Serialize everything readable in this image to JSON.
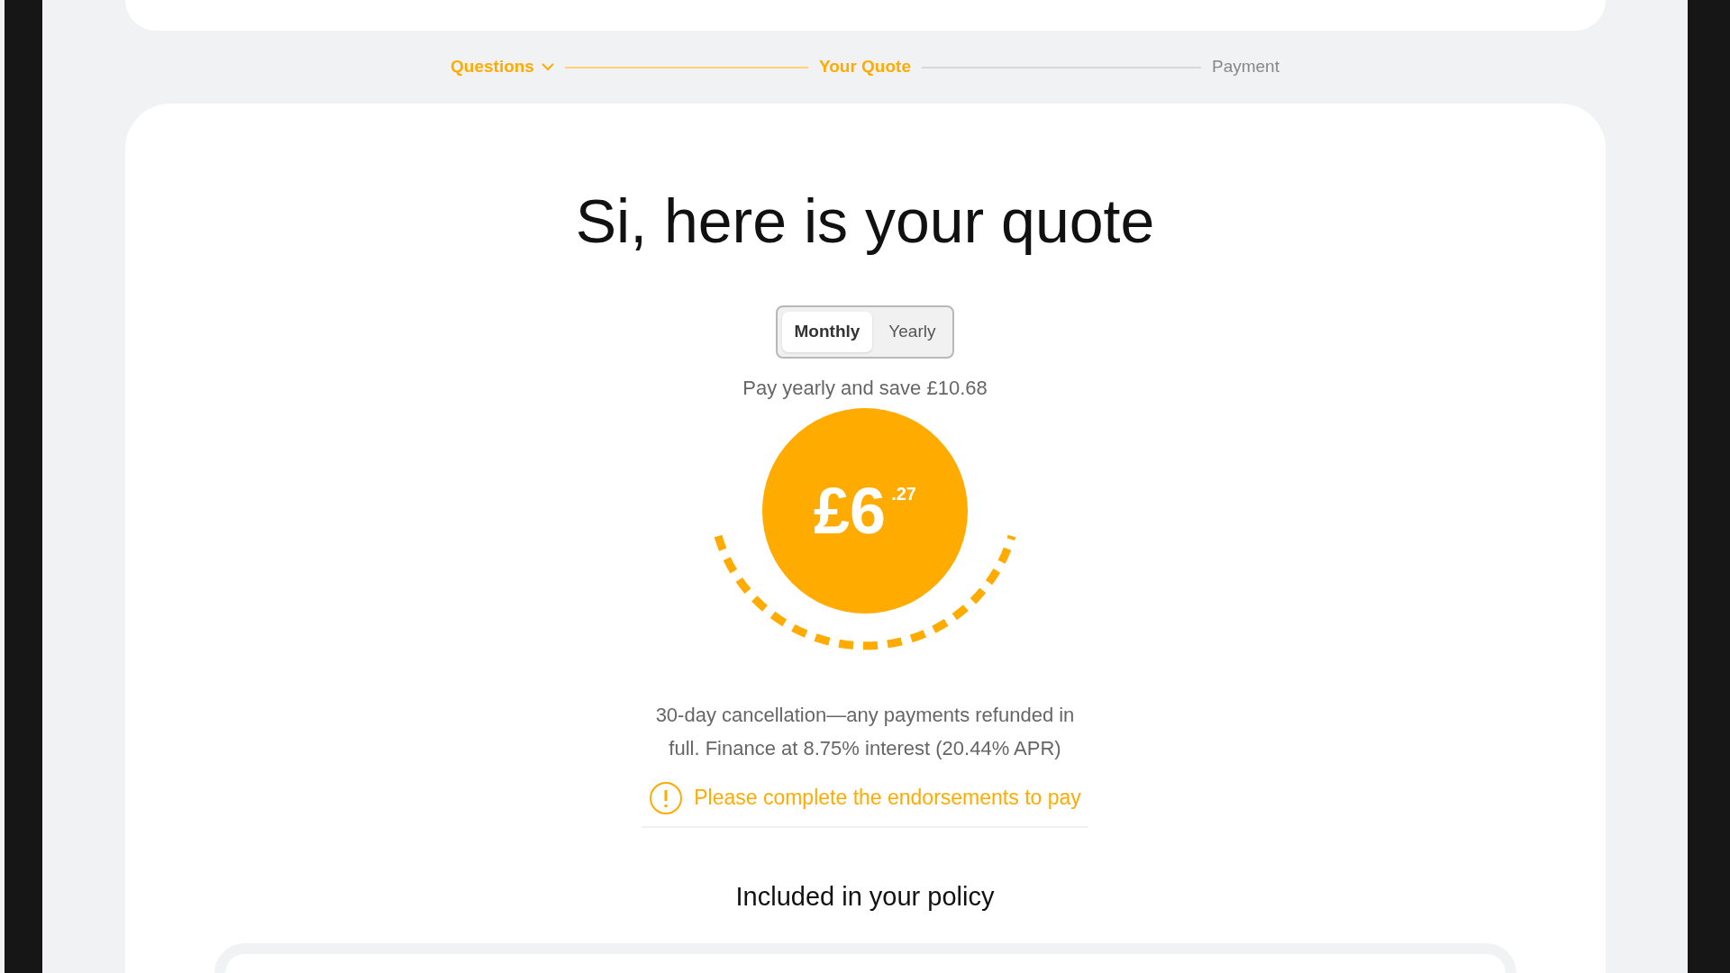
{
  "steps": [
    {
      "label": "Questions",
      "reached": true,
      "has_menu": true
    },
    {
      "label": "Your Quote",
      "reached": true,
      "has_menu": false
    },
    {
      "label": "Payment",
      "reached": false,
      "has_menu": false
    }
  ],
  "quote": {
    "title": "Si, here is your quote",
    "billing_options": [
      {
        "label": "Monthly",
        "selected": true
      },
      {
        "label": "Yearly",
        "selected": false
      }
    ],
    "saving_note": "Pay yearly and save £10.68",
    "price": {
      "whole": "£6",
      "pence": ".27"
    },
    "terms": "30-day cancellation—any payments refunded in full. Finance at 8.75% interest (20.44% APR)",
    "warning": "Please complete the endorsements to pay",
    "included_heading": "Included in your policy"
  }
}
